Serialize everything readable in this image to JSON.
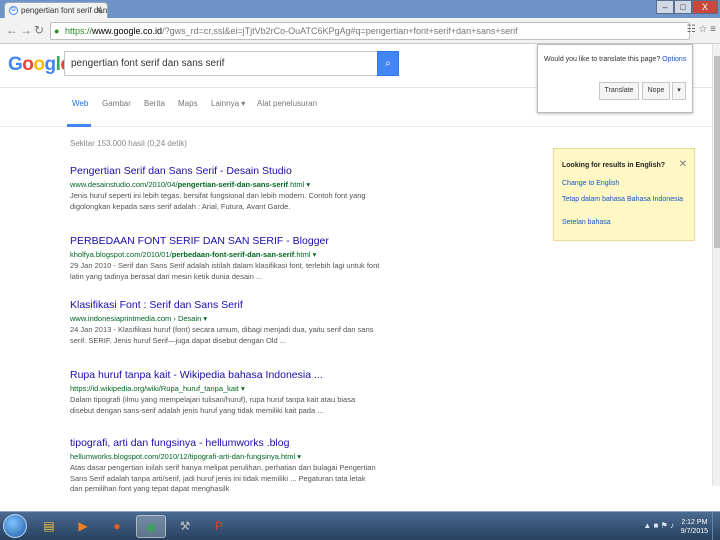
{
  "browser": {
    "tab_title": "pengertian font serif dan",
    "tab_close": "X",
    "window_buttons": [
      "–",
      "□",
      "X"
    ],
    "back_icon": "←",
    "forward_icon": "→",
    "reload_icon": "↻",
    "address": {
      "scheme": "https://",
      "host": "www.google.co.id",
      "path": "/?gws_rd=cr,ssl&ei=jTjtVb2rCo-OuATC6KPgAg#q=pengertian+font+serif+dan+sans+serif"
    },
    "toolbar_icons": "☷ ☆ ≡"
  },
  "google": {
    "logo_letters": [
      {
        "ch": "G",
        "color": "#4285f4"
      },
      {
        "ch": "o",
        "color": "#ea4335"
      },
      {
        "ch": "o",
        "color": "#fbbc05"
      },
      {
        "ch": "g",
        "color": "#4285f4"
      },
      {
        "ch": "l",
        "color": "#34a853"
      },
      {
        "ch": "e",
        "color": "#ea4335"
      }
    ],
    "query": "pengertian font serif dan sans serif",
    "search_icon": "⌕",
    "tabs": [
      "Web",
      "Gambar",
      "Berita",
      "Maps",
      "Lainnya ▾",
      "Alat penelusuran"
    ],
    "stats": "Sekitar 153.000 hasil (0,24 detik)"
  },
  "results": [
    {
      "title": "Pengertian Serif dan Sans Serif - Desain Studio",
      "url_pre": "www.desainstudio.com/2010/04/",
      "url_bold": "pengertian-serif-dan-sans-serif",
      "url_post": ".html",
      "snippet": "Jenis huruf seperti ini lebih tegas, bersifat fungsional dan lebih modern. Contoh font yang digolongkan kepada sans serif adalah : Arial, Futura, Avant Garde."
    },
    {
      "title": "PERBEDAAN FONT SERIF DAN SAN SERIF - Blogger",
      "url_pre": "kholfya.blogspot.com/2010/01/",
      "url_bold": "perbedaan-font-serif-dan-san-serif",
      "url_post": ".html",
      "snippet": "29 Jan 2010 - Serif dan Sans Serif adalah istilah dalam klasifikasi font, terlebih lagi untuk font latin yang tadinya berasal dari mesin ketik dunia desain ..."
    },
    {
      "title": "Klasifikasi Font : Serif dan Sans Serif",
      "url_pre": "www.indonesiaprintmedia.com › Desain",
      "url_bold": "",
      "url_post": "",
      "snippet": "24 Jan 2013 - Klasifikasi huruf (font) secara umum, dibagi menjadi dua, yaitu serif dan sans serif. SERIF. Jenis huruf Serif—juga dapat disebut dengan Old ..."
    },
    {
      "title": "Rupa huruf tanpa kait - Wikipedia bahasa Indonesia ...",
      "url_pre": "https://id.wikipedia.org/wiki/Rupa_huruf_tanpa_kait",
      "url_bold": "",
      "url_post": "",
      "snippet": "Dalam tipografi (ilmu yang mempelajari tulisan/huruf), rupa huruf tanpa kait atau biasa disebut dengan sans-serif adalah jenis huruf yang tidak memiliki kait pada ..."
    },
    {
      "title": "tipografi, arti dan fungsinya - hellumworks .blog",
      "url_pre": "hellumworks.blogspot.com/2010/12/tipografi-arti-dan-fungsinya.html",
      "url_bold": "",
      "url_post": "",
      "snippet": "Atas dasar pengertian inilah serif hanya melipat perulihan, perhatian dan bulagai Pengertian Sans Serif adalah tanpa arti/serif, jadi huruf jenis ini tidak memiliki ... Pegaturan tata letak dan pemilihan font yang tepat dapat menghasilk"
    }
  ],
  "translate_popup": {
    "question": "Would you like to translate this page?",
    "options_label": "Options",
    "translate_label": "Translate",
    "nope_label": "Nope",
    "menu_icon": "▾"
  },
  "english_panel": {
    "heading": "Looking for results in English?",
    "close": "✕",
    "change_link": "Change to English",
    "keep_link": "Tetap dalam bahasa Bahasa Indonesia",
    "settings_link": "Setelan bahasa"
  },
  "taskbar": {
    "apps": [
      {
        "name": "folder-app",
        "glyph": "▤",
        "color": "#f0c040"
      },
      {
        "name": "media-app",
        "glyph": "▶",
        "color": "#f08020"
      },
      {
        "name": "firefox-app",
        "glyph": "●",
        "color": "#e06020"
      },
      {
        "name": "chrome-app",
        "glyph": "◉",
        "color": "#34a853"
      },
      {
        "name": "tools-app",
        "glyph": "⚒",
        "color": "#c0c0c0"
      },
      {
        "name": "powerpoint-app",
        "glyph": "P",
        "color": "#d24726"
      }
    ],
    "tray_icons": "▲ ■ ⚑ ♪",
    "time": "2:12 PM",
    "date": "9/7/2015"
  }
}
